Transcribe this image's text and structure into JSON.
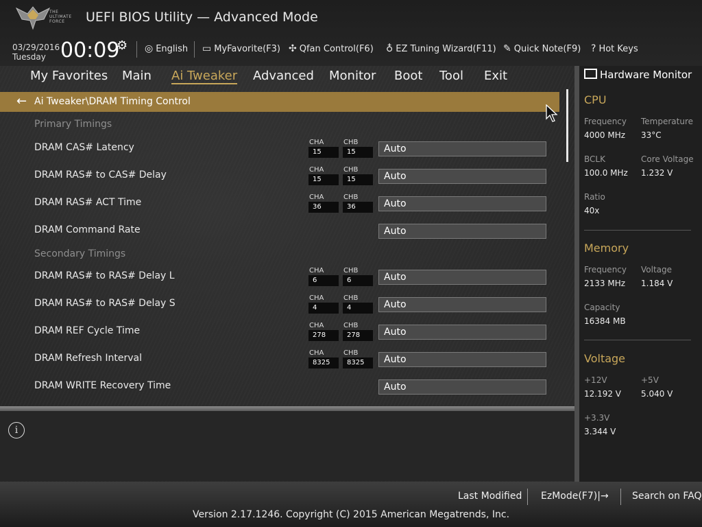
{
  "app": {
    "title": "UEFI BIOS Utility — Advanced Mode",
    "logo_text": [
      "THE",
      "ULTIMATE",
      "FORCE"
    ]
  },
  "header": {
    "date": "03/29/2016",
    "day": "Tuesday",
    "time": "00:09",
    "tools": [
      {
        "label": "English",
        "icon": "globe-icon"
      },
      {
        "label": "MyFavorite(F3)",
        "icon": "favorite-icon"
      },
      {
        "label": "Qfan Control(F6)",
        "icon": "fan-icon"
      },
      {
        "label": "EZ Tuning Wizard(F11)",
        "icon": "bulb-icon"
      },
      {
        "label": "Quick Note(F9)",
        "icon": "note-icon"
      },
      {
        "label": "Hot Keys",
        "icon": "question-icon"
      }
    ]
  },
  "nav": {
    "tabs": [
      "My Favorites",
      "Main",
      "Ai Tweaker",
      "Advanced",
      "Monitor",
      "Boot",
      "Tool",
      "Exit"
    ],
    "active": "Ai Tweaker"
  },
  "breadcrumb": "Ai Tweaker\\DRAM Timing Control",
  "sections": {
    "primary": "Primary Timings",
    "secondary": "Secondary Timings"
  },
  "channel_labels": {
    "a": "CHA",
    "b": "CHB"
  },
  "items": [
    {
      "label": "DRAM CAS# Latency",
      "cha": "15",
      "chb": "15",
      "value": "Auto"
    },
    {
      "label": "DRAM RAS# to CAS# Delay",
      "cha": "15",
      "chb": "15",
      "value": "Auto"
    },
    {
      "label": "DRAM RAS# ACT Time",
      "cha": "36",
      "chb": "36",
      "value": "Auto"
    },
    {
      "label": "DRAM Command Rate",
      "cha": "",
      "chb": "",
      "value": "Auto"
    },
    {
      "label": "DRAM RAS# to RAS# Delay L",
      "cha": "6",
      "chb": "6",
      "value": "Auto"
    },
    {
      "label": "DRAM RAS# to RAS# Delay S",
      "cha": "4",
      "chb": "4",
      "value": "Auto"
    },
    {
      "label": "DRAM REF Cycle Time",
      "cha": "278",
      "chb": "278",
      "value": "Auto"
    },
    {
      "label": "DRAM Refresh Interval",
      "cha": "8325",
      "chb": "8325",
      "value": "Auto"
    },
    {
      "label": "DRAM WRITE Recovery Time",
      "cha": "",
      "chb": "",
      "value": "Auto"
    }
  ],
  "hardware_monitor": {
    "title": "Hardware Monitor",
    "cpu": {
      "heading": "CPU",
      "frequency_label": "Frequency",
      "frequency": "4000 MHz",
      "temperature_label": "Temperature",
      "temperature": "33°C",
      "bclk_label": "BCLK",
      "bclk": "100.0 MHz",
      "core_voltage_label": "Core Voltage",
      "core_voltage": "1.232 V",
      "ratio_label": "Ratio",
      "ratio": "40x"
    },
    "memory": {
      "heading": "Memory",
      "frequency_label": "Frequency",
      "frequency": "2133 MHz",
      "voltage_label": "Voltage",
      "voltage": "1.184 V",
      "capacity_label": "Capacity",
      "capacity": "16384 MB"
    },
    "voltage": {
      "heading": "Voltage",
      "v12_label": "+12V",
      "v12": "12.192 V",
      "v5_label": "+5V",
      "v5": "5.040 V",
      "v33_label": "+3.3V",
      "v33": "3.344 V"
    }
  },
  "footer": {
    "last_modified": "Last Modified",
    "ezmode": "EzMode(F7)|→",
    "faq": "Search on FAQ",
    "version": "Version 2.17.1246. Copyright (C) 2015 American Megatrends, Inc."
  },
  "colors": {
    "accent": "#c8a75a",
    "breadcrumb_bg": "#9a7a3c"
  }
}
